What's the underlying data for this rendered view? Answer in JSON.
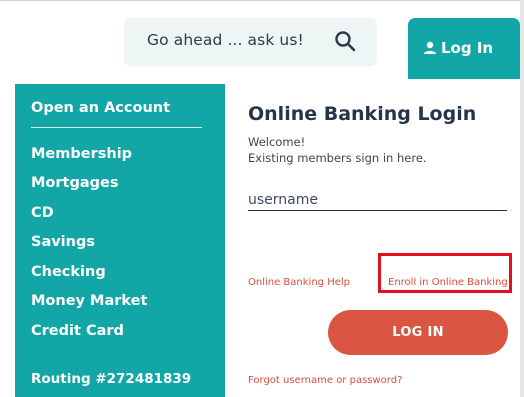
{
  "search": {
    "text": "Go ahead ... ask us!"
  },
  "header": {
    "login_label": "Log In"
  },
  "nav": {
    "title": "Open an Account",
    "items": [
      {
        "label": "Membership"
      },
      {
        "label": "Mortgages"
      },
      {
        "label": "CD"
      },
      {
        "label": "Savings"
      },
      {
        "label": "Checking"
      },
      {
        "label": "Money Market"
      },
      {
        "label": "Credit Card"
      }
    ],
    "routing": "Routing #272481839"
  },
  "login": {
    "title": "Online Banking Login",
    "welcome_line1": "Welcome!",
    "welcome_line2": "Existing members sign in here.",
    "username_placeholder": "username",
    "help_link": "Online Banking Help",
    "enroll_link": "Enroll in Online Banking",
    "submit_label": "LOG IN",
    "forgot_link": "Forgot username or password?"
  },
  "colors": {
    "brand_teal": "#13a6a6",
    "accent_red": "#db5543",
    "highlight_box": "#e01020",
    "heading": "#25344a"
  }
}
